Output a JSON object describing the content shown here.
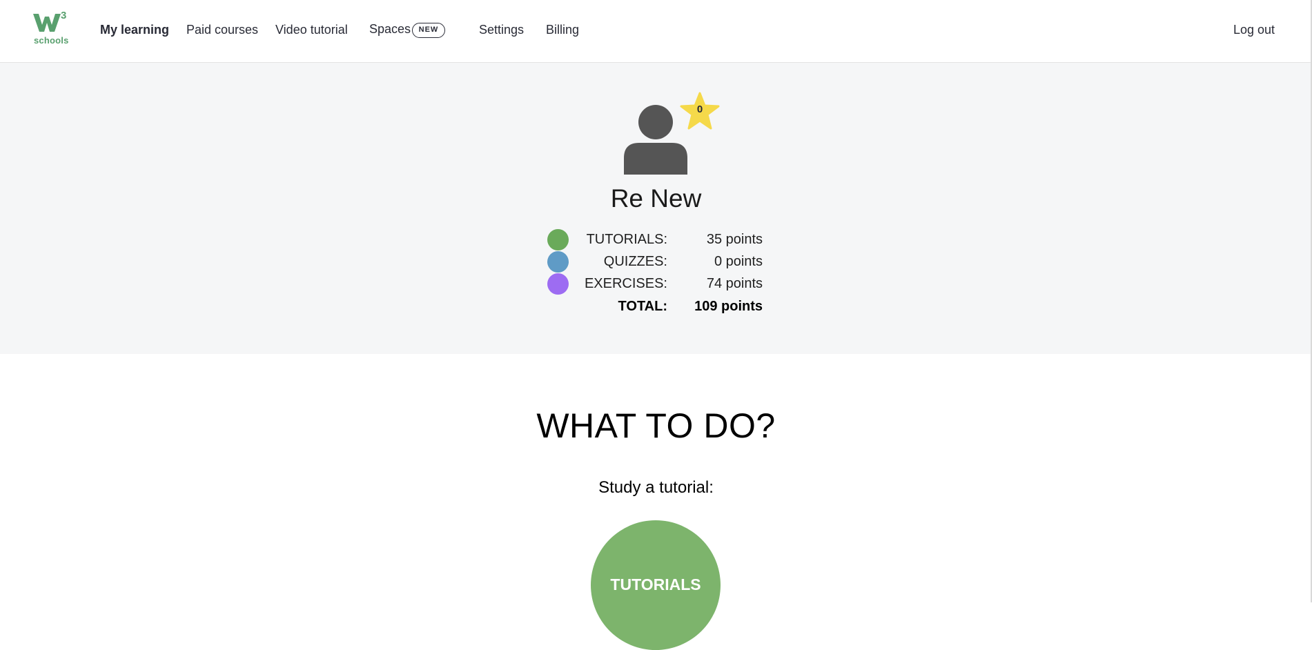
{
  "nav": {
    "logo_text": "schools",
    "logo_sup": "3",
    "items": [
      {
        "label": "My learning"
      },
      {
        "label": "Paid courses"
      },
      {
        "label": "Video tutorial"
      },
      {
        "label": "Spaces"
      },
      {
        "label": "Settings"
      },
      {
        "label": "Billing"
      }
    ],
    "spaces_badge": "NEW",
    "logout_label": "Log out"
  },
  "profile": {
    "star_count": "0",
    "name": "Re New",
    "stats": [
      {
        "label": "TUTORIALS:",
        "value": "35 points",
        "color": "#6aaa5a"
      },
      {
        "label": "QUIZZES:",
        "value": "0 points",
        "color": "#5f9bc6"
      },
      {
        "label": "EXERCISES:",
        "value": "74 points",
        "color": "#9d6cf2"
      }
    ],
    "total_label": "TOTAL:",
    "total_value": "109 points"
  },
  "todo": {
    "heading": "WHAT TO DO?",
    "subheading": "Study a tutorial:",
    "tutorials_button": "TUTORIALS"
  },
  "colors": {
    "brand_green": "#59a06e",
    "tutorials_green": "#7db46c",
    "star_yellow": "#f5d94a",
    "avatar_gray": "#555555"
  },
  "icons": {
    "logo": "w3schools-logo",
    "avatar": "user-avatar-icon",
    "star": "star-icon"
  }
}
